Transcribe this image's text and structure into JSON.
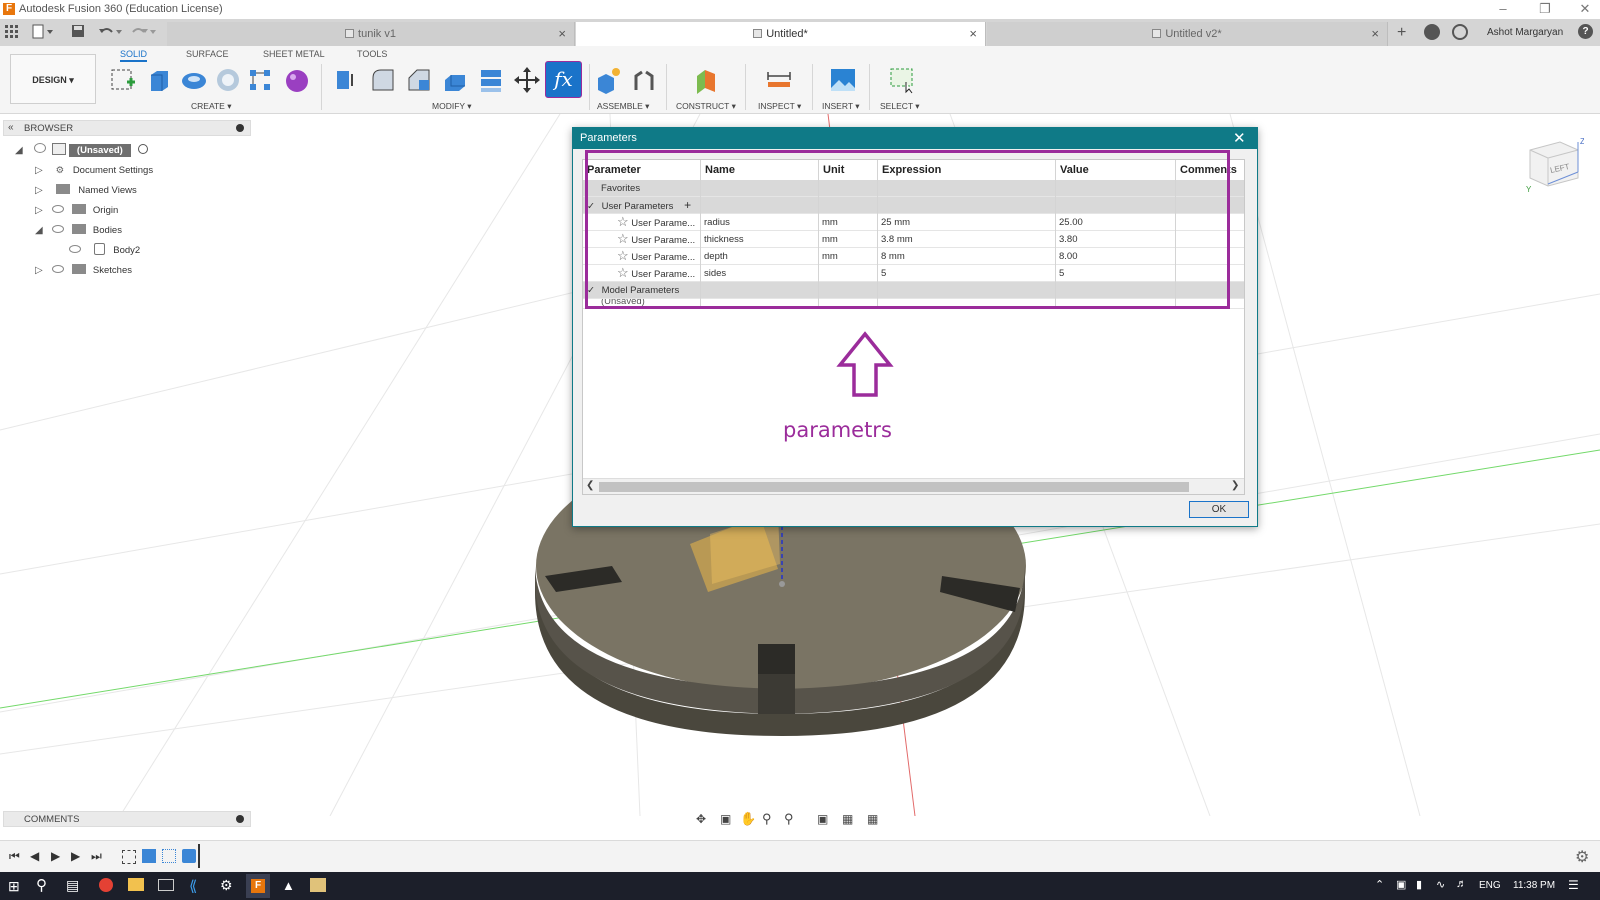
{
  "window": {
    "title": "Autodesk Fusion 360 (Education License)",
    "app_icon": "F"
  },
  "doc_tabs": [
    {
      "label": "tunik v1",
      "active": false
    },
    {
      "label": "Untitled*",
      "active": true
    },
    {
      "label": "Untitled v2*",
      "active": false
    }
  ],
  "user": {
    "name": "Ashot Margaryan"
  },
  "workspace_tabs": [
    "SOLID",
    "SURFACE",
    "SHEET METAL",
    "TOOLS"
  ],
  "design_button": "DESIGN ▾",
  "toolbar_groups": {
    "create": "CREATE ▾",
    "modify": "MODIFY ▾",
    "assemble": "ASSEMBLE ▾",
    "construct": "CONSTRUCT ▾",
    "inspect": "INSPECT ▾",
    "insert": "INSERT ▾",
    "select": "SELECT ▾"
  },
  "browser": {
    "title": "BROWSER",
    "root": "(Unsaved)",
    "nodes": [
      "Document Settings",
      "Named Views",
      "Origin",
      "Bodies",
      "Body2",
      "Sketches"
    ]
  },
  "comments": {
    "title": "COMMENTS"
  },
  "viewcube": {
    "face": "LEFT"
  },
  "dialog": {
    "title": "Parameters",
    "columns": [
      "Parameter",
      "Name",
      "Unit",
      "Expression",
      "Value",
      "Comments"
    ],
    "groups": {
      "favorites": "Favorites",
      "user": "User Parameters",
      "model": "Model Parameters",
      "unsaved": "(Unsaved)"
    },
    "user_params": [
      {
        "type": "User Parame...",
        "name": "radius",
        "unit": "mm",
        "expression": "25 mm",
        "value": "25.00"
      },
      {
        "type": "User Parame...",
        "name": "thickness",
        "unit": "mm",
        "expression": "3.8 mm",
        "value": "3.80"
      },
      {
        "type": "User Parame...",
        "name": "depth",
        "unit": "mm",
        "expression": "8 mm",
        "value": "8.00"
      },
      {
        "type": "User Parame...",
        "name": "sides",
        "unit": "",
        "expression": "5",
        "value": "5"
      }
    ],
    "ok_label": "OK"
  },
  "annotation": {
    "text": "parametrs",
    "color": "#9b2c9b"
  },
  "taskbar": {
    "lang": "ENG",
    "time": "11:38 PM"
  },
  "colors": {
    "accent": "#1a73c9",
    "dialog_title": "#0f7a87",
    "annotation": "#9b2c9b"
  }
}
